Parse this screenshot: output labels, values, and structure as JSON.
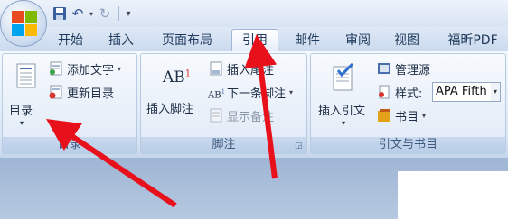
{
  "qat": {
    "save_icon": "save-icon",
    "undo_icon": "undo-icon",
    "redo_icon": "redo-icon",
    "customize_icon": "customize-qat-icon"
  },
  "tabs": [
    {
      "label": "开始"
    },
    {
      "label": "插入"
    },
    {
      "label": "页面布局"
    },
    {
      "label": "引用"
    },
    {
      "label": "邮件"
    },
    {
      "label": "审阅"
    },
    {
      "label": "视图"
    },
    {
      "label": "福昕PDF"
    }
  ],
  "active_tab": "引用",
  "groups": {
    "toc": {
      "big_button": "目录",
      "add_text": "添加文字",
      "update_toc": "更新目录",
      "label": "目录"
    },
    "footnote": {
      "insert_footnote": "插入脚注",
      "insert_endnote": "插入尾注",
      "next_footnote": "下一条脚注",
      "show_notes": "显示备注",
      "label": "脚注",
      "ab_glyph": "AB",
      "sup_glyph": "1"
    },
    "citation": {
      "insert_citation": "插入引文",
      "manage_sources": "管理源",
      "style_label": "样式:",
      "style_value": "APA Fifth",
      "bibliography": "书目",
      "label": "引文与书目"
    }
  },
  "colors": {
    "arrow": "#e8101a",
    "ribbon_text": "#1e395b"
  }
}
